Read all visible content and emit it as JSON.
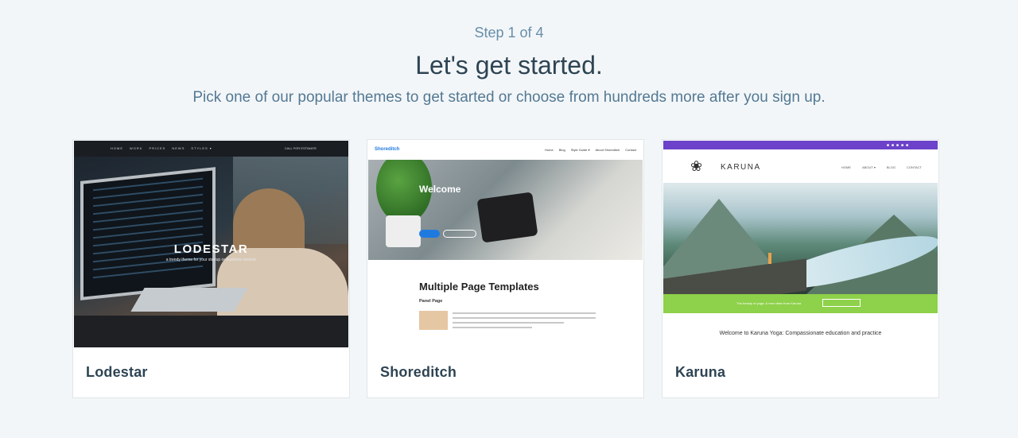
{
  "header": {
    "step": "Step 1 of 4",
    "title": "Let's get started.",
    "subtitle": "Pick one of our popular themes to get started or choose from hundreds more after you sign up."
  },
  "themes": [
    {
      "name": "Lodestar",
      "preview": {
        "nav": [
          "HOME",
          "WORK",
          "PRICES",
          "NEWS",
          "STYLES ▾"
        ],
        "cta": "CALL FOR ESTIMATE",
        "logo": "LODESTAR",
        "tagline": "a trendy theme for your startup or business venture"
      }
    },
    {
      "name": "Shoreditch",
      "preview": {
        "brand": "Shoreditch",
        "nav": [
          "Home",
          "Blog",
          "Style Guide ▾",
          "About Shoreditch",
          "Contact"
        ],
        "hero_title": "Welcome",
        "section_title": "Multiple Page Templates",
        "section_subtitle": "Panel Page"
      }
    },
    {
      "name": "Karuna",
      "preview": {
        "brand": "KARUNA",
        "nav": [
          "HOME",
          "ABOUT ▾",
          "BLOG",
          "CONTACT"
        ],
        "band_text": "The beauty of yoga: & new vibes from Karuna",
        "welcome": "Welcome to Karuna Yoga: Compassionate education and practice"
      }
    }
  ],
  "colors": {
    "background": "#f3f6f8",
    "title": "#2e4453",
    "subtitle": "#537994",
    "karuna_topbar": "#6b42c9",
    "karuna_band": "#8ed14a",
    "shoreditch_accent": "#1f7ae0"
  }
}
